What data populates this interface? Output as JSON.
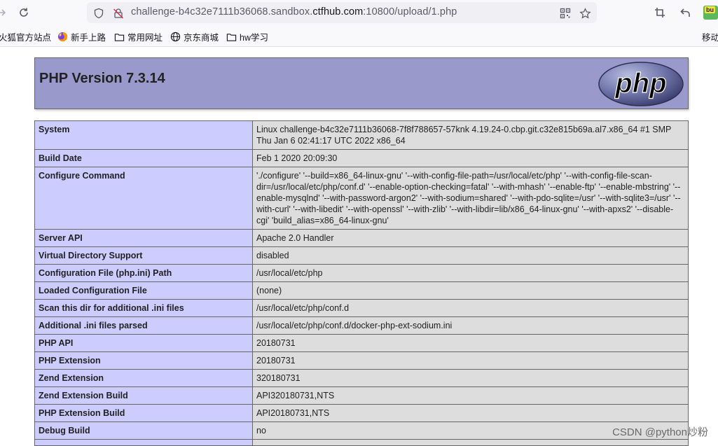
{
  "browser": {
    "url_prefix": "challenge-b4c32e7111b36068.sandbox.",
    "url_domain": "ctfhub.com",
    "url_suffix": ":10800/upload/1.php",
    "bookmarks": [
      {
        "label": "火狐官方站点",
        "icon": "firefox-icon"
      },
      {
        "label": "新手上路",
        "icon": "firefox-icon"
      },
      {
        "label": "常用网址",
        "icon": "folder-icon"
      },
      {
        "label": "京东商城",
        "icon": "globe-icon"
      },
      {
        "label": "hw学习",
        "icon": "folder-icon"
      },
      {
        "label": "移动",
        "icon": ""
      }
    ],
    "extension_badge": "bu"
  },
  "php": {
    "title": "PHP Version 7.3.14",
    "logo_text": "php",
    "rows": [
      {
        "key": "System",
        "value": "Linux challenge-b4c32e7111b36068-7f8f788657-57knk 4.19.24-0.cbp.git.c32e815b69a.al7.x86_64 #1 SMP Thu Jan 6 02:41:17 UTC 2022 x86_64"
      },
      {
        "key": "Build Date",
        "value": "Feb 1 2020 20:09:30"
      },
      {
        "key": "Configure Command",
        "value": "'./configure' '--build=x86_64-linux-gnu' '--with-config-file-path=/usr/local/etc/php' '--with-config-file-scan-dir=/usr/local/etc/php/conf.d' '--enable-option-checking=fatal' '--with-mhash' '--enable-ftp' '--enable-mbstring' '--enable-mysqlnd' '--with-password-argon2' '--with-sodium=shared' '--with-pdo-sqlite=/usr' '--with-sqlite3=/usr' '--with-curl' '--with-libedit' '--with-openssl' '--with-zlib' '--with-libdir=lib/x86_64-linux-gnu' '--with-apxs2' '--disable-cgi' 'build_alias=x86_64-linux-gnu'"
      },
      {
        "key": "Server API",
        "value": "Apache 2.0 Handler"
      },
      {
        "key": "Virtual Directory Support",
        "value": "disabled"
      },
      {
        "key": "Configuration File (php.ini) Path",
        "value": "/usr/local/etc/php"
      },
      {
        "key": "Loaded Configuration File",
        "value": "(none)"
      },
      {
        "key": "Scan this dir for additional .ini files",
        "value": "/usr/local/etc/php/conf.d"
      },
      {
        "key": "Additional .ini files parsed",
        "value": "/usr/local/etc/php/conf.d/docker-php-ext-sodium.ini"
      },
      {
        "key": "PHP API",
        "value": "20180731"
      },
      {
        "key": "PHP Extension",
        "value": "20180731"
      },
      {
        "key": "Zend Extension",
        "value": "320180731"
      },
      {
        "key": "Zend Extension Build",
        "value": "API320180731,NTS"
      },
      {
        "key": "PHP Extension Build",
        "value": "API20180731,NTS"
      },
      {
        "key": "Debug Build",
        "value": "no"
      },
      {
        "key": "",
        "value": ""
      }
    ]
  },
  "watermark": "CSDN @python炒粉"
}
